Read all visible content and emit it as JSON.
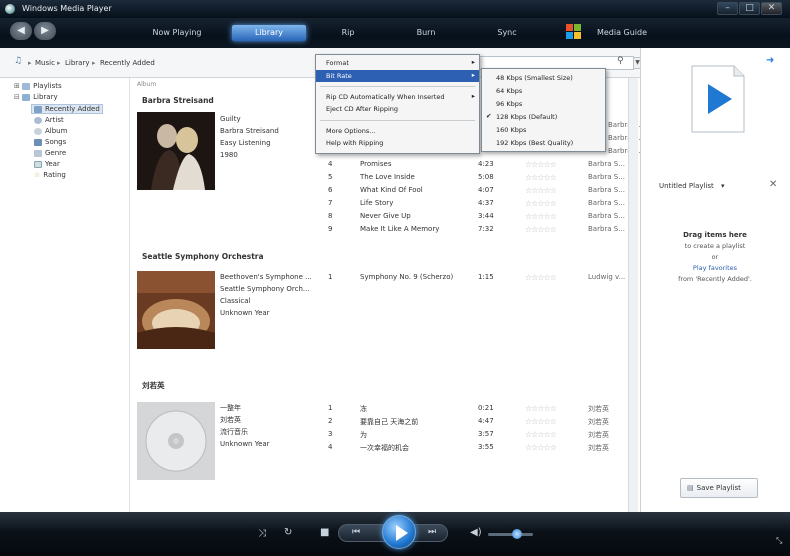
{
  "window": {
    "title": "Windows Media Player"
  },
  "nav": {
    "tabs": [
      "Now Playing",
      "Library",
      "Rip",
      "Burn",
      "Sync",
      "Media Guide"
    ],
    "active_tab": "Library"
  },
  "breadcrumb": [
    "Music",
    "Library",
    "Recently Added"
  ],
  "tree": {
    "playlists": "Playlists",
    "library": "Library",
    "items": [
      "Recently Added",
      "Artist",
      "Album",
      "Songs",
      "Genre",
      "Year",
      "Rating"
    ]
  },
  "column_header": "Album",
  "albums": [
    {
      "header": "Barbra Streisand",
      "meta": [
        "Guilty",
        "Barbra Streisand",
        "Easy Listening",
        "1980"
      ],
      "tracks": [
        {
          "n": "4",
          "title": "Promises",
          "len": "4:23",
          "artist": "Barbra S..."
        },
        {
          "n": "5",
          "title": "The Love Inside",
          "len": "5:08",
          "artist": "Barbra S..."
        },
        {
          "n": "6",
          "title": "What Kind Of Fool",
          "len": "4:07",
          "artist": "Barbra S..."
        },
        {
          "n": "7",
          "title": "Life Story",
          "len": "4:37",
          "artist": "Barbra S..."
        },
        {
          "n": "8",
          "title": "Never Give Up",
          "len": "3:44",
          "artist": "Barbra S..."
        },
        {
          "n": "9",
          "title": "Make It Like A Memory",
          "len": "7:32",
          "artist": "Barbra S..."
        }
      ],
      "partial_artists": [
        "Barbra S...",
        "Barbra S...",
        "Barbra S..."
      ]
    },
    {
      "header": "Seattle Symphony Orchestra",
      "meta": [
        "Beethoven's Symphone ...",
        "Seattle Symphony Orch...",
        "Classical",
        "Unknown Year"
      ],
      "tracks": [
        {
          "n": "1",
          "title": "Symphony No. 9 (Scherzo)",
          "len": "1:15",
          "artist": "Ludwig v..."
        }
      ]
    },
    {
      "header": "刘若英",
      "meta": [
        "一整年",
        "刘若英",
        "流行音乐",
        "Unknown Year"
      ],
      "tracks": [
        {
          "n": "1",
          "title": "冻",
          "len": "0:21",
          "artist": "刘若英"
        },
        {
          "n": "2",
          "title": "要靠自己 天海之前",
          "len": "4:47",
          "artist": "刘若英"
        },
        {
          "n": "3",
          "title": "为",
          "len": "3:57",
          "artist": "刘若英"
        },
        {
          "n": "4",
          "title": "一次幸福的机会",
          "len": "3:55",
          "artist": "刘若英"
        }
      ]
    }
  ],
  "rip_menu": {
    "items": [
      "Format",
      "Bit Rate",
      "Rip CD Automatically When Inserted",
      "Eject CD After Ripping",
      "More Options...",
      "Help with Ripping"
    ],
    "highlighted": "Bit Rate"
  },
  "bitrate_menu": {
    "items": [
      "48 Kbps (Smallest Size)",
      "64 Kbps",
      "96 Kbps",
      "128 Kbps (Default)",
      "160 Kbps",
      "192 Kbps (Best Quality)"
    ],
    "checked": "128 Kbps (Default)"
  },
  "list_pane": {
    "playlist_name": "Untitled Playlist",
    "drag_title": "Drag items here",
    "drag_sub": "to create a playlist",
    "or": "or",
    "play_favorites": "Play favorites",
    "from": "from 'Recently Added'.",
    "save_button": "Save Playlist"
  },
  "colors": {
    "accent": "#2d60b3",
    "play": "#1f78d1"
  },
  "icons": [
    "back-icon",
    "forward-icon",
    "shuffle-icon",
    "repeat-icon",
    "stop-icon",
    "prev-icon",
    "play-icon",
    "next-icon",
    "volume-icon"
  ]
}
